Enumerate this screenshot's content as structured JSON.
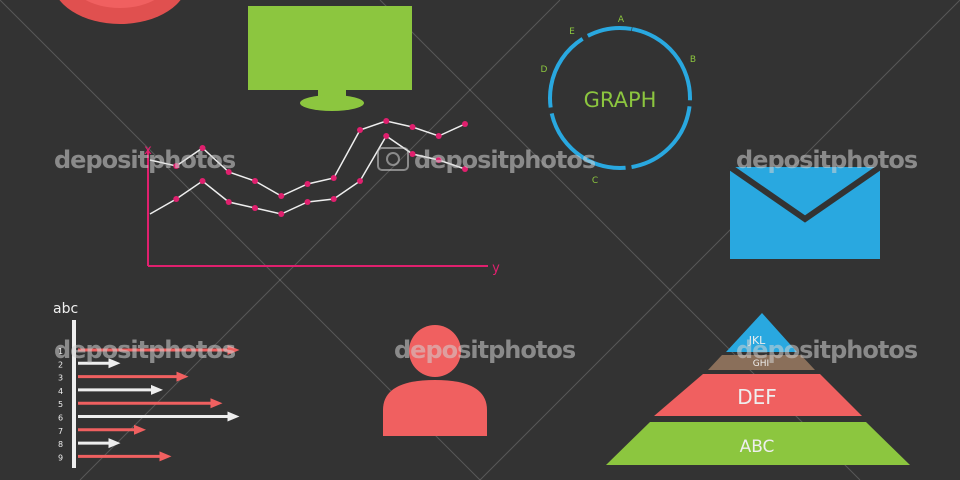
{
  "colors": {
    "background": "#333333",
    "red": "#f06060",
    "green": "#8cc63f",
    "blue": "#29a8e0",
    "pink": "#e0206e",
    "brown": "#8a6f5a",
    "light": "#eeeeee"
  },
  "icons": {
    "top_left": "circle-badge-icon",
    "monitor": "monitor-icon",
    "graph": "circle-graph-icon",
    "line_chart": "line-chart-icon",
    "mail": "envelope-icon",
    "bar_chart": "horizontal-arrow-bar-chart-icon",
    "user": "user-icon",
    "pyramid": "pyramid-chart-icon"
  },
  "graph_circle": {
    "center_label": "GRAPH",
    "points": [
      "A",
      "B",
      "C",
      "D",
      "E"
    ]
  },
  "line_chart": {
    "x_axis_label": "y",
    "y_axis_label": "x",
    "series_1": [
      3,
      2.8,
      3.4,
      2.6,
      2.3,
      1.8,
      2.2,
      2.4,
      4.0,
      4.3,
      4.1,
      3.8,
      4.2
    ],
    "series_2": [
      1.2,
      1.7,
      2.3,
      1.6,
      1.4,
      1.2,
      1.6,
      1.7,
      2.3,
      3.8,
      3.2,
      3.0,
      2.7
    ]
  },
  "bar_chart": {
    "title": "abc",
    "rows": [
      "1",
      "2",
      "3",
      "4",
      "5",
      "6",
      "7",
      "8",
      "9"
    ],
    "values": [
      0.95,
      0.25,
      0.65,
      0.5,
      0.85,
      0.95,
      0.4,
      0.25,
      0.55
    ],
    "row_colors": [
      "red",
      "light",
      "red",
      "light",
      "red",
      "light",
      "red",
      "light",
      "red"
    ]
  },
  "pyramid": {
    "tiers": [
      "JKL",
      "GHI",
      "DEF",
      "ABC"
    ]
  },
  "watermark": {
    "text": "depositphotos"
  }
}
